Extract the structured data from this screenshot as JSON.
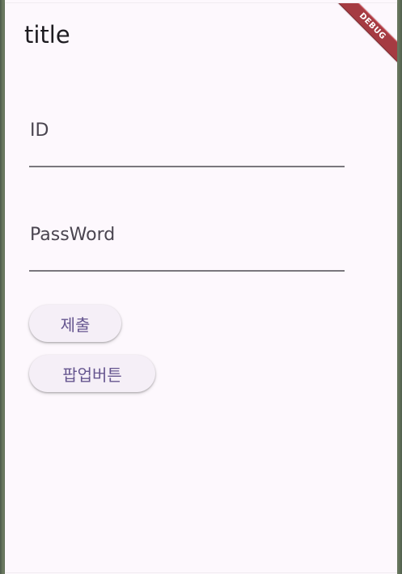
{
  "app": {
    "title": "title",
    "debug_banner": "DEBUG"
  },
  "form": {
    "id_label": "ID",
    "password_label": "PassWord"
  },
  "buttons": {
    "submit": "제출",
    "popup": "팝업버튼"
  },
  "colors": {
    "background": "#fdf8fd",
    "button_bg": "#f5eff7",
    "button_text": "#65558f",
    "debug_banner": "#a53b42"
  }
}
